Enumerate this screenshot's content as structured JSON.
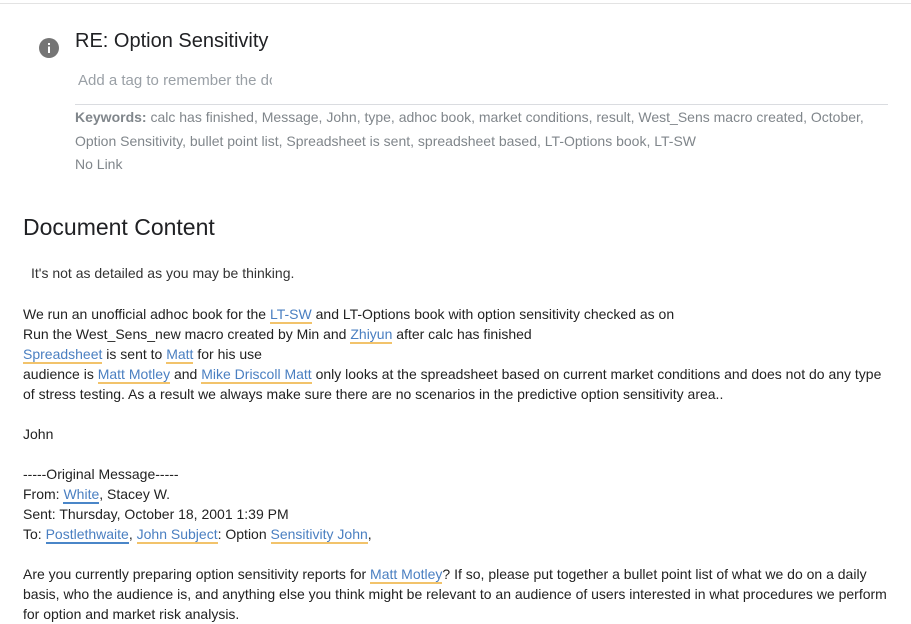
{
  "email": {
    "title": "RE: Option Sensitivity",
    "tag_placeholder": "Add a tag to remember the document",
    "keywords_label": "Keywords:",
    "keywords_text": "calc has finished, Message, John, type, adhoc book, market conditions, result, West_Sens macro created, October, Option Sensitivity, bullet point list, Spreadsheet is sent, spreadsheet based, LT-Options book, LT-SW",
    "no_link": "No Link"
  },
  "document": {
    "heading": "Document Content",
    "intro": "It's not as detailed as you may be thinking.",
    "p1": {
      "t1": "We run an unofficial adhoc book for the ",
      "e1": "LT-SW",
      "t2": " and LT-Options book with option sensitivity checked as on"
    },
    "p2": {
      "t1": "Run the West_Sens_new macro created by Min and ",
      "e1": "Zhiyun",
      "t2": " after calc has finished"
    },
    "p3": {
      "e1": "Spreadsheet",
      "t1": " is sent to ",
      "e2": "Matt",
      "t2": " for his use"
    },
    "p4": {
      "t1": "audience is ",
      "e1": "Matt Motley",
      "t2": " and ",
      "e2": "Mike Driscoll Matt",
      "t3": " only looks at the spreadsheet based on current market conditions and does not do any type of stress testing. As a result we always make sure there are no scenarios in the predictive option sensitivity area.."
    },
    "sign": "John",
    "orig_header": "-----Original Message-----",
    "from": {
      "t1": "From: ",
      "e1": "White",
      "t2": ", Stacey W."
    },
    "sent": "Sent: Thursday, October 18, 2001 1:39 PM",
    "to": {
      "t1": "To: ",
      "e1": "Postlethwaite",
      "t2": ", ",
      "e2": "John Subject",
      "t3": ": Option ",
      "e3": "Sensitivity John",
      "t4": ","
    },
    "question": {
      "t1": "Are you currently preparing option sensitivity reports for ",
      "e1": "Matt Motley",
      "t2": "? If so, please put together a bullet point list of what we do on a daily basis, who the audience is, and anything else you think might be relevant to an audience of users interested in what procedures we perform for option and market risk analysis."
    }
  },
  "colors": {
    "entity_underline_orange": "#f2c36b",
    "entity_underline_blue": "#4a86c8",
    "entity_link": "#4a7fc1"
  },
  "icons": {
    "info": "info-circle-icon"
  }
}
